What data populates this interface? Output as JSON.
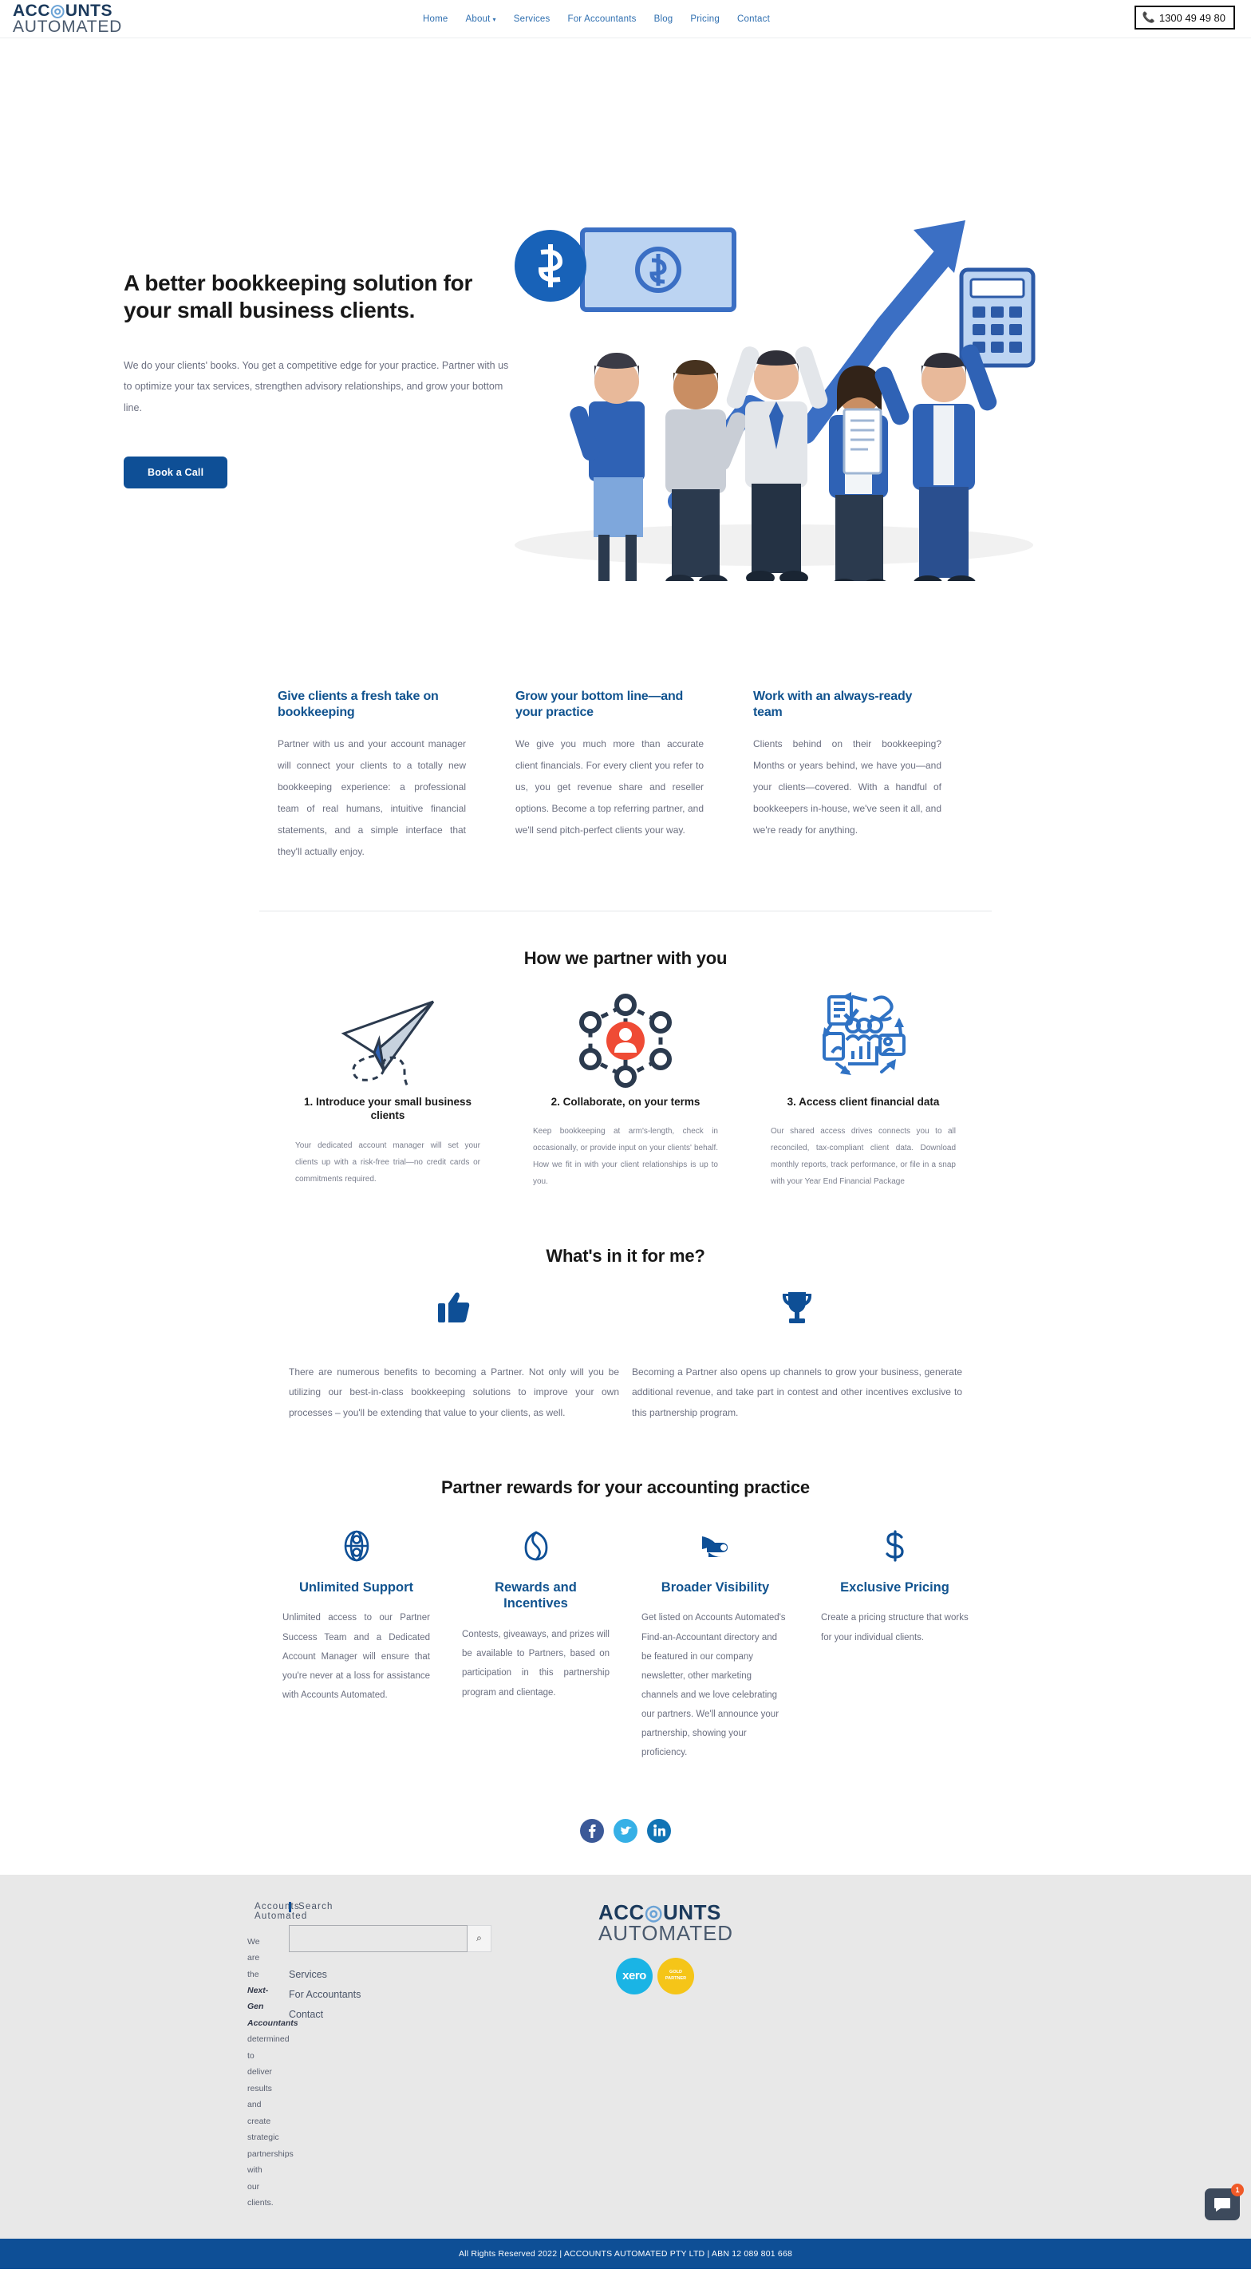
{
  "header": {
    "logo_line1": "ACCOUNTS",
    "logo_line2": "AUTOMATED",
    "nav": [
      {
        "label": "Home",
        "has_caret": false
      },
      {
        "label": "About",
        "has_caret": true
      },
      {
        "label": "Services",
        "has_caret": false
      },
      {
        "label": "For Accountants",
        "has_caret": false
      },
      {
        "label": "Blog",
        "has_caret": false
      },
      {
        "label": "Pricing",
        "has_caret": false
      },
      {
        "label": "Contact",
        "has_caret": false
      }
    ],
    "phone_icon": "phone-icon",
    "phone": "1300 49 49 80"
  },
  "hero": {
    "title": "A better bookkeeping solution for your small business clients.",
    "subtitle": "We do your clients' books. You get a competitive edge for your practice. Partner with us to optimize your tax services, strengthen advisory relationships, and grow your bottom line.",
    "cta": "Book a Call"
  },
  "benefits": [
    {
      "title": "Give clients a fresh take on bookkeeping",
      "body": "Partner with us and your account manager will connect your clients to a totally new bookkeeping experience: a professional team of real humans, intuitive financial statements, and a simple interface that they'll actually enjoy."
    },
    {
      "title": "Grow your bottom line—and your practice",
      "body": "We give you much more than accurate client financials. For every client you refer to us, you get revenue share and reseller options. Become a top referring partner, and we'll send pitch-perfect clients your way."
    },
    {
      "title": "Work with an always-ready team",
      "body": "Clients behind on their bookkeeping? Months or years behind, we have you—and your clients—covered. With a handful of bookkeepers in-house, we've seen it all, and we're ready for anything."
    }
  ],
  "partner": {
    "heading": "How we partner with you",
    "steps": [
      {
        "icon": "paper-plane-icon",
        "title": "1. Introduce your small business clients",
        "body": "Your dedicated account manager will set your clients up with a risk-free trial—no credit cards or commitments required."
      },
      {
        "icon": "network-collaboration-icon",
        "title": "2. Collaborate, on your terms",
        "body": "Keep bookkeeping at arm's-length, check in occasionally, or provide input on your clients' behalf. How we fit in with your client relationships is up to you."
      },
      {
        "icon": "financial-data-cycle-icon",
        "title": "3. Access client financial data",
        "body": "Our shared access drives connects you to all reconciled, tax-compliant client data. Download monthly reports, track performance, or file in a snap with your Year End Financial Package"
      }
    ]
  },
  "wiifm": {
    "heading": "What's in it for me?",
    "items": [
      {
        "icon": "thumbs-up-icon",
        "glyph": "👍",
        "body": "There are numerous benefits to becoming a Partner. Not only will you be utilizing our best-in-class bookkeeping solutions to improve your own processes – you'll be extending that value to your clients, as well."
      },
      {
        "icon": "trophy-icon",
        "glyph": "🏆",
        "body": "Becoming a Partner also opens up channels to grow your business, generate additional revenue, and take part in contest and other incentives exclusive to this partnership program."
      }
    ]
  },
  "rewards": {
    "heading": "Partner rewards for your accounting practice",
    "items": [
      {
        "icon": "lifebuoy-support-icon",
        "title": "Unlimited Support",
        "body": "Unlimited access to our Partner Success Team and a Dedicated Account Manager will ensure that you're never at a loss for assistance with Accounts Automated."
      },
      {
        "icon": "gift-rewards-icon",
        "title": "Rewards and Incentives",
        "body": "Contests, giveaways, and prizes will be available to Partners, based on participation in this partnership program and clientage."
      },
      {
        "icon": "megaphone-visibility-icon",
        "title": "Broader Visibility",
        "body": "Get listed on Accounts Automated's Find-an-Accountant directory and be featured in our company newsletter, other marketing channels and we love celebrating our partners. We'll announce your partnership, showing your proficiency."
      },
      {
        "icon": "dollar-pricing-icon",
        "title": "Exclusive Pricing",
        "body": "Create a pricing structure that works for your individual clients."
      }
    ]
  },
  "social": [
    {
      "name": "facebook-icon",
      "glyph": "f",
      "color": "#3b5998"
    },
    {
      "name": "twitter-icon",
      "glyph": "Ŧ",
      "color": "#36b0e6"
    },
    {
      "name": "linkedin-icon",
      "glyph": "in",
      "color": "#1174b5"
    }
  ],
  "footer": {
    "about_heading": "Accounts Automated",
    "about_text_pre": "We are the ",
    "about_text_bold": "Next-Gen Accountants",
    "about_text_post": " determined to deliver results and create strategic partnerships with our clients.",
    "search_heading": "Search",
    "search_value": "",
    "search_placeholder": "",
    "search_icon": "search-icon",
    "links": [
      "Services",
      "For Accountants",
      "Contact"
    ],
    "logo_line1": "ACCOUNTS",
    "logo_line2": "AUTOMATED",
    "badges": [
      {
        "name": "xero-badge",
        "label": "xero"
      },
      {
        "name": "gold-partner-badge",
        "label": "GOLD\nPARTNER"
      }
    ],
    "copyright": "All Rights Reserved 2022 | ACCOUNTS AUTOMATED PTY LTD | ABN 12 089 801 668"
  },
  "chat": {
    "icon": "chat-bubble-icon",
    "badge": "1"
  }
}
